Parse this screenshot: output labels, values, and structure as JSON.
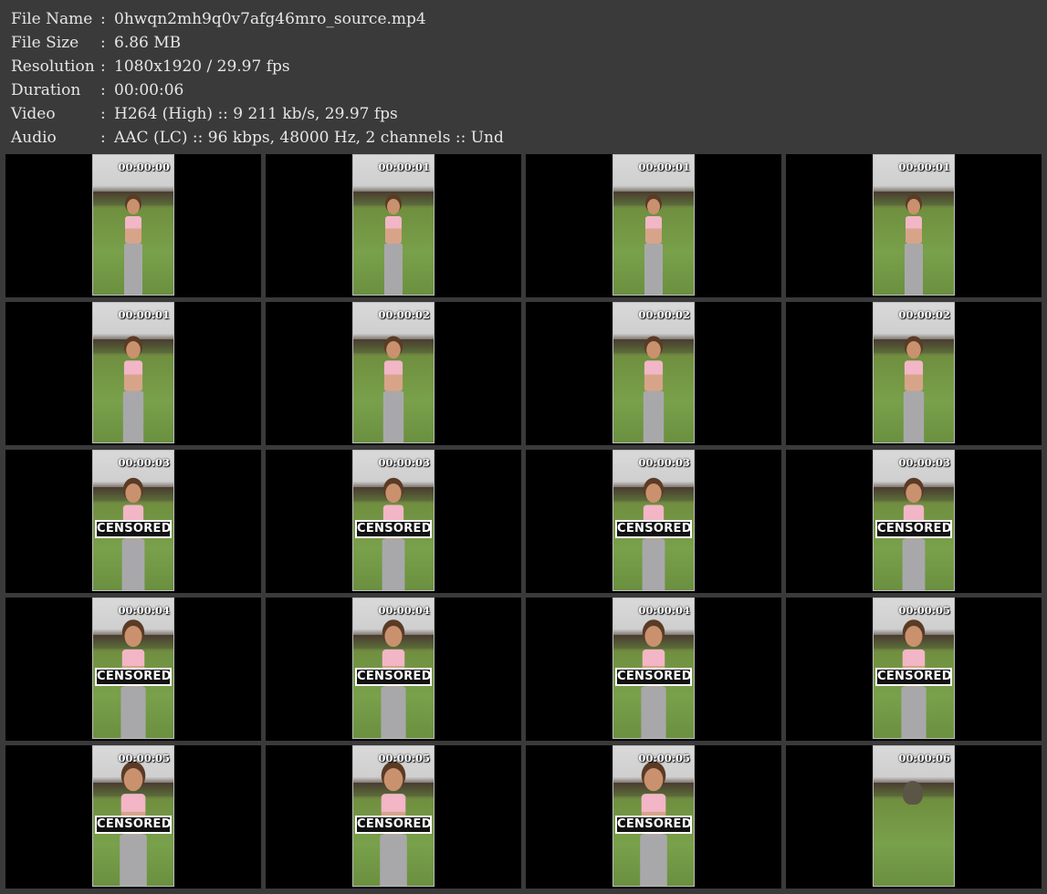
{
  "info": [
    {
      "key": "File Name",
      "sep": ":",
      "value": "0hwqn2mh9q0v7afg46mro_source.mp4"
    },
    {
      "key": "File Size",
      "sep": ":",
      "value": "6.86 MB"
    },
    {
      "key": "Resolution",
      "sep": ":",
      "value": "1080x1920 / 29.97 fps"
    },
    {
      "key": "Duration",
      "sep": ":",
      "value": "00:00:06"
    },
    {
      "key": "Video",
      "sep": ":",
      "value": "H264 (High) :: 9 211 kb/s, 29.97 fps"
    },
    {
      "key": "Audio",
      "sep": ":",
      "value": "AAC (LC) :: 96 kbps, 48000 Hz, 2 channels :: Und"
    }
  ],
  "censor_label": "CENSORED",
  "thumbnails": [
    {
      "time": "00:00:00",
      "censored": false,
      "scene": "person"
    },
    {
      "time": "00:00:01",
      "censored": false,
      "scene": "person"
    },
    {
      "time": "00:00:01",
      "censored": false,
      "scene": "person"
    },
    {
      "time": "00:00:01",
      "censored": false,
      "scene": "person"
    },
    {
      "time": "00:00:01",
      "censored": false,
      "scene": "person"
    },
    {
      "time": "00:00:02",
      "censored": false,
      "scene": "person"
    },
    {
      "time": "00:00:02",
      "censored": false,
      "scene": "person"
    },
    {
      "time": "00:00:02",
      "censored": false,
      "scene": "person"
    },
    {
      "time": "00:00:03",
      "censored": true,
      "scene": "person"
    },
    {
      "time": "00:00:03",
      "censored": true,
      "scene": "person"
    },
    {
      "time": "00:00:03",
      "censored": true,
      "scene": "person"
    },
    {
      "time": "00:00:03",
      "censored": true,
      "scene": "person"
    },
    {
      "time": "00:00:04",
      "censored": true,
      "scene": "person"
    },
    {
      "time": "00:00:04",
      "censored": true,
      "scene": "person"
    },
    {
      "time": "00:00:04",
      "censored": true,
      "scene": "person"
    },
    {
      "time": "00:00:05",
      "censored": true,
      "scene": "person"
    },
    {
      "time": "00:00:05",
      "censored": true,
      "scene": "person"
    },
    {
      "time": "00:00:05",
      "censored": true,
      "scene": "person"
    },
    {
      "time": "00:00:05",
      "censored": true,
      "scene": "person"
    },
    {
      "time": "00:00:06",
      "censored": false,
      "scene": "landscape"
    }
  ]
}
